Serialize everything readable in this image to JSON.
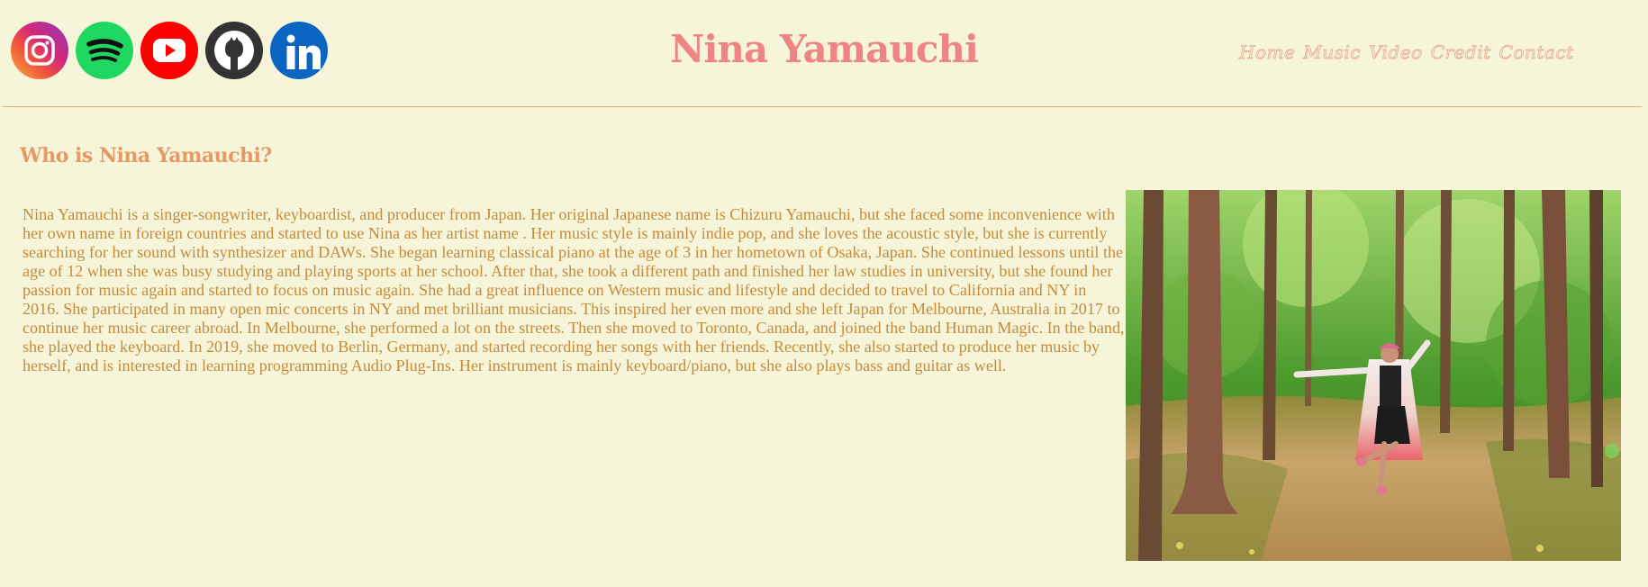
{
  "header": {
    "title": "Nina Yamauchi",
    "social": [
      {
        "name": "instagram-icon"
      },
      {
        "name": "spotify-icon"
      },
      {
        "name": "youtube-icon"
      },
      {
        "name": "github-icon"
      },
      {
        "name": "linkedin-icon"
      }
    ],
    "nav": [
      "Home",
      "Music",
      "Video",
      "Credit",
      "Contact"
    ]
  },
  "about": {
    "heading": "Who is Nina Yamauchi?",
    "bio": "Nina Yamauchi is a singer-songwriter, keyboardist, and producer from Japan. Her original Japanese name is Chizuru Yamauchi, but she faced some inconvenience with her own name in foreign countries and started to use Nina as her artist name . Her music style is mainly indie pop, and she loves the acoustic style, but she is currently searching for her sound with synthesizer and DAWs. She began learning classical piano at the age of 3 in her hometown of Osaka, Japan. She continued lessons until the age of 12 when she was busy studying and playing sports at her school. After that, she took a different path and finished her law studies in university, but she found her passion for music again and started to focus on music again. She had a great influence on Western music and lifestyle and decided to travel to California and NY in 2016. She participated in many open mic concerts in NY and met brilliant musicians. This inspired her even more and she left Japan for Melbourne, Australia in 2017 to continue her music career abroad. In Melbourne, she performed a lot on the streets. Then she moved to Toronto, Canada, and joined the band Human Magic. In the band, she played the keyboard. In 2019, she moved to Berlin, Germany, and started recording her songs with her friends. Recently, she also started to produce her music by herself, and is interested in learning programming Audio Plug-Ins. Her instrument is mainly keyboard/piano, but she also plays bass and guitar as well."
  },
  "colors": {
    "background": "#f6f5da",
    "title": "#ef8484",
    "heading": "#e49a63",
    "body_text": "#c58a3a",
    "divider": "#e9b06e"
  }
}
